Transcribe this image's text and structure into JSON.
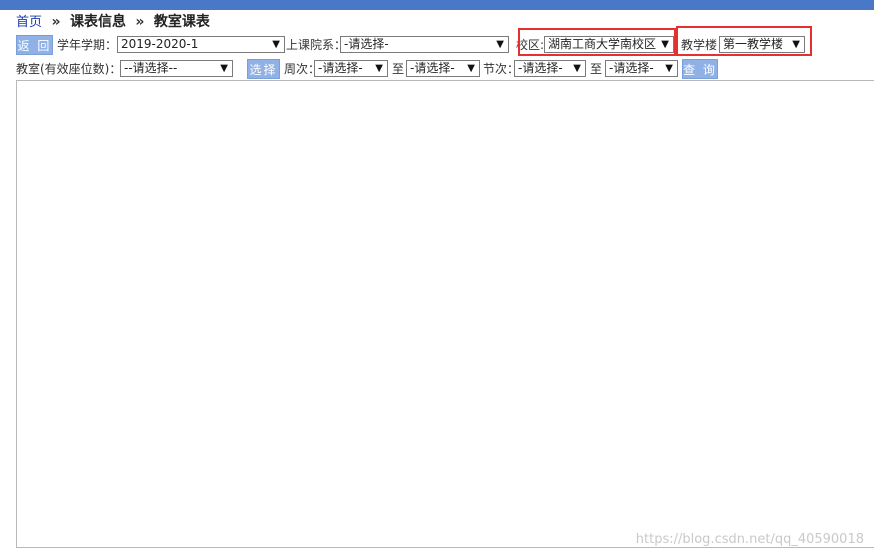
{
  "breadcrumb": {
    "home": "首页",
    "sep1": "»",
    "level2": "课表信息",
    "sep2": "»",
    "current": "教室课表"
  },
  "toolbar": {
    "back_label": "返 回",
    "term_label": "学年学期：",
    "term_value": "2019-2020-1",
    "dept_label": "上课院系：",
    "dept_value": "-请选择-",
    "campus_label": "校区:",
    "campus_value": "湖南工商大学南校区",
    "building_label": "教学楼",
    "building_value": "第一教学楼",
    "room_label": "教室(有效座位数)：",
    "room_value": "--请选择--",
    "select_label": "选择",
    "week_label": "周次：",
    "week_from": "-请选择-",
    "to_label_1": "至",
    "week_to": "-请选择-",
    "section_label": "节次：",
    "section_from": "-请选择-",
    "to_label_2": "至",
    "section_to": "-请选择-",
    "query_label": "查 询"
  },
  "icons": {
    "dropdown": "chevron-down-icon"
  },
  "colors": {
    "topbar": "#4a78c8",
    "button": "#8fb1e6",
    "highlight": "#e53030",
    "link": "#1a3aa8"
  },
  "watermark": "https://blog.csdn.net/qq_40590018"
}
